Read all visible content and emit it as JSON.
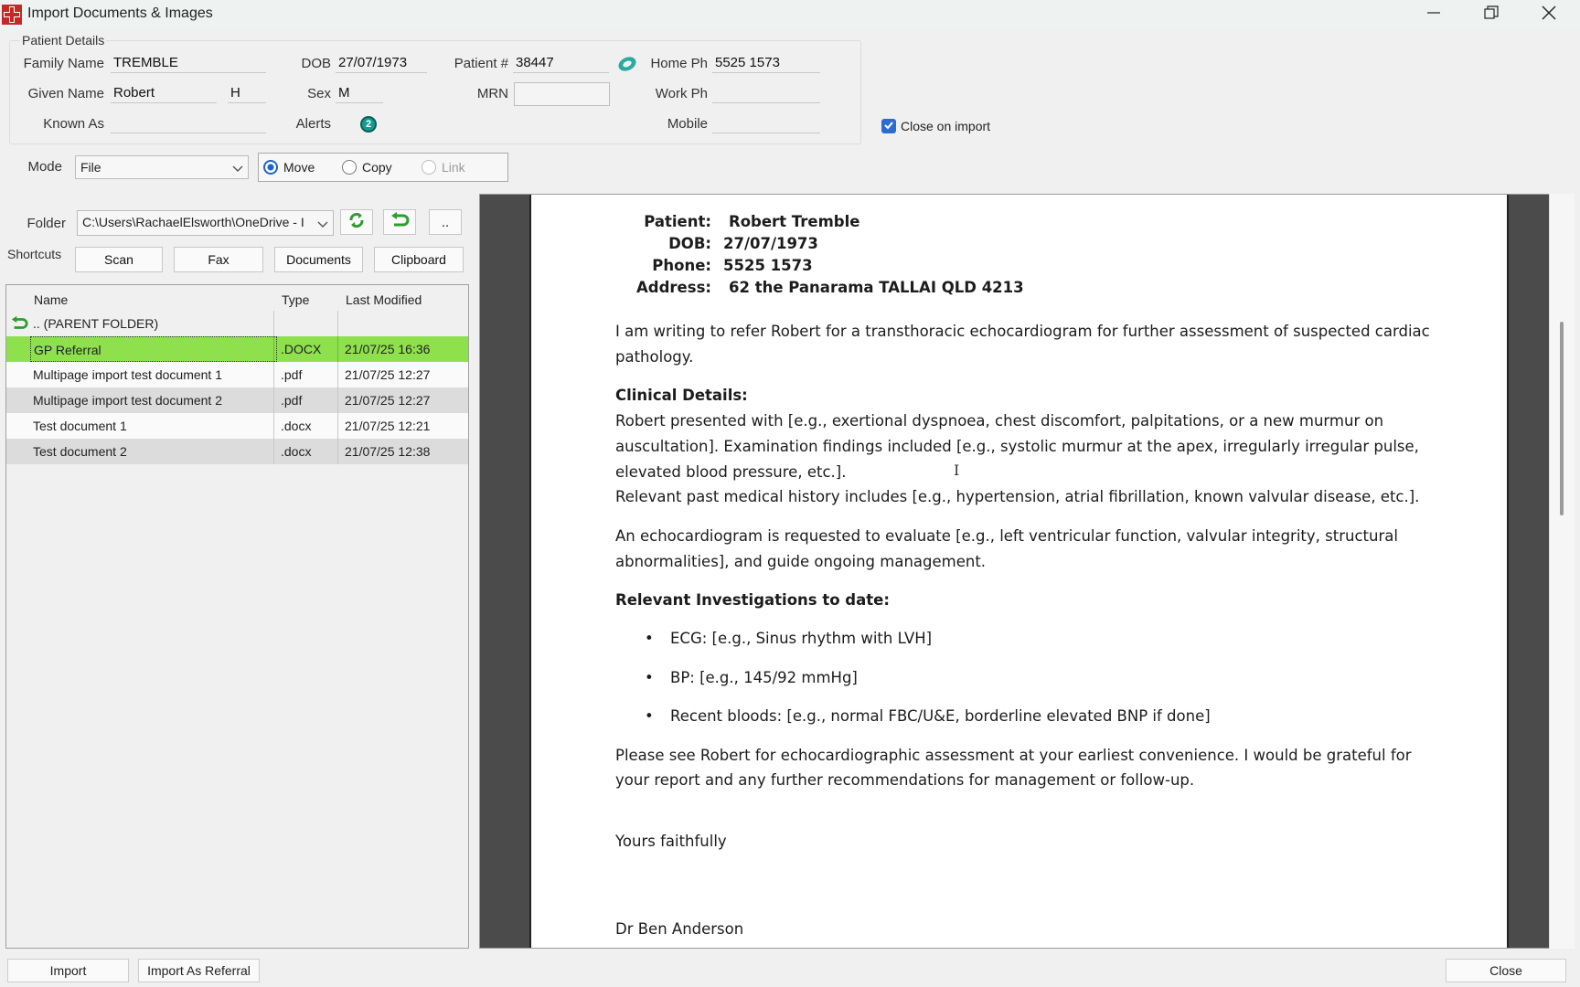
{
  "window": {
    "title": "Import Documents & Images"
  },
  "patient": {
    "group_label": "Patient Details",
    "family_name_label": "Family Name",
    "family_name": "TREMBLE",
    "dob_label": "DOB",
    "dob": "27/07/1973",
    "patient_no_label": "Patient #",
    "patient_no": "38447",
    "home_ph_label": "Home Ph",
    "home_ph": "5525 1573",
    "given_name_label": "Given Name",
    "given_name": "Robert",
    "middle_initial": "H",
    "sex_label": "Sex",
    "sex": "M",
    "mrn_label": "MRN",
    "mrn": "",
    "work_ph_label": "Work Ph",
    "work_ph": "",
    "known_as_label": "Known As",
    "known_as": "",
    "alerts_label": "Alerts",
    "alerts_count": "2",
    "mobile_label": "Mobile",
    "mobile": "",
    "close_on_import_label": "Close on import",
    "close_on_import": true
  },
  "mode": {
    "label": "Mode",
    "value": "File",
    "options": [
      {
        "label": "Move",
        "selected": true,
        "enabled": true
      },
      {
        "label": "Copy",
        "selected": false,
        "enabled": true
      },
      {
        "label": "Link",
        "selected": false,
        "enabled": false
      }
    ]
  },
  "folder": {
    "label": "Folder",
    "path": "C:\\Users\\RachaelElsworth\\OneDrive - I",
    "up_label": ".."
  },
  "shortcuts": {
    "label": "Shortcuts",
    "buttons": [
      "Scan",
      "Fax",
      "Documents",
      "Clipboard"
    ]
  },
  "file_list": {
    "columns": [
      "Name",
      "Type",
      "Last Modified"
    ],
    "parent_label": ".. (PARENT FOLDER)",
    "rows": [
      {
        "name": "GP Referral",
        "type": ".DOCX",
        "modified": "21/07/25 16:36"
      },
      {
        "name": "Multipage import test document 1",
        "type": ".pdf",
        "modified": "21/07/25 12:27"
      },
      {
        "name": "Multipage import test document 2",
        "type": ".pdf",
        "modified": "21/07/25 12:27"
      },
      {
        "name": "Test document 1",
        "type": ".docx",
        "modified": "21/07/25 12:21"
      },
      {
        "name": "Test document 2",
        "type": ".docx",
        "modified": "21/07/25 12:38"
      }
    ]
  },
  "document": {
    "patient_label": "Patient:",
    "patient_value": "Robert Tremble",
    "dob_label": "DOB:",
    "dob_value": "27/07/1973",
    "phone_label": "Phone:",
    "phone_value": "5525 1573",
    "address_label": "Address:",
    "address_value": "62 the Panarama TALLAI QLD 4213",
    "intro_l1": "I am writing to refer Robert for a transthoracic echocardiogram for further assessment of suspected cardiac",
    "intro_l2": "pathology.",
    "clinical_heading": "Clinical Details:",
    "clinical_l1": "Robert presented with [e.g., exertional dyspnoea, chest discomfort, palpitations, or a new murmur on",
    "clinical_l2": "auscultation]. Examination findings included [e.g., systolic murmur at the apex, irregularly irregular pulse,",
    "clinical_l3": "elevated blood pressure, etc.].",
    "clinical_l4": "Relevant past medical history includes [e.g., hypertension, atrial fibrillation, known valvular disease, etc.].",
    "echo_l1": "An echocardiogram is requested to evaluate [e.g., left ventricular function, valvular integrity, structural",
    "echo_l2": "abnormalities], and guide ongoing management.",
    "invest_heading": "Relevant Investigations to date:",
    "bullets": [
      "ECG: [e.g., Sinus rhythm with LVH]",
      "BP: [e.g., 145/92 mmHg]",
      "Recent bloods: [e.g., normal FBC/U&E, borderline elevated BNP if done]"
    ],
    "closing_l1": "Please see Robert for echocardiographic assessment at your earliest convenience. I would be grateful for",
    "closing_l2": "your report and any further recommendations for management or follow-up.",
    "signoff": "Yours faithfully",
    "signer": "Dr Ben Anderson"
  },
  "footer": {
    "import_label": "Import",
    "import_referral_label": "Import As Referral",
    "close_label": "Close"
  },
  "colors": {
    "selected_row": "#8ee14d",
    "accent": "#1f63c7",
    "app_icon": "#c62828"
  }
}
